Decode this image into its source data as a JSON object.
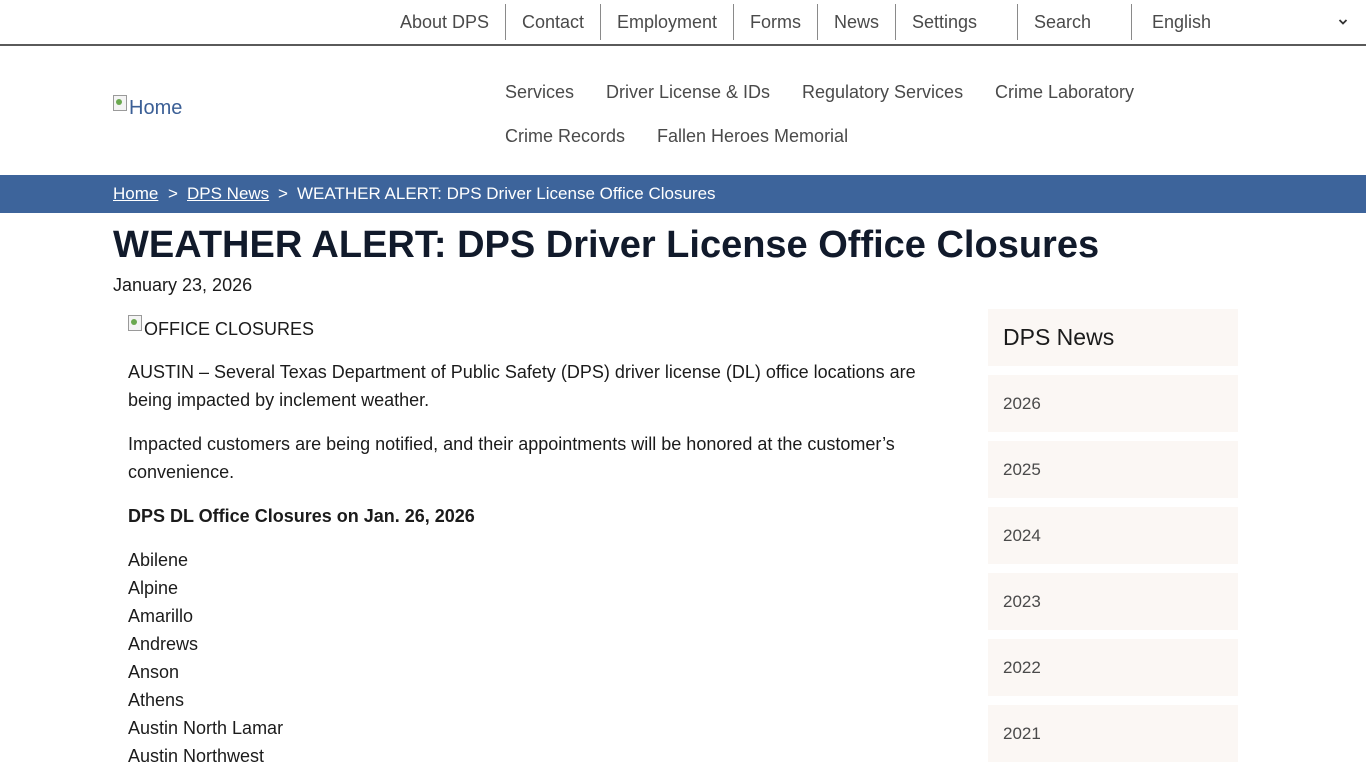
{
  "utility_nav": {
    "items": [
      "About DPS",
      "Contact",
      "Employment",
      "Forms",
      "News",
      "Settings",
      "Search"
    ],
    "language": {
      "selected": "English",
      "icon": "chevron-down-icon"
    }
  },
  "header": {
    "logo_alt": "Home",
    "main_nav": [
      "Services",
      "Driver License & IDs",
      "Regulatory Services",
      "Crime Laboratory",
      "Crime Records",
      "Fallen Heroes Memorial"
    ]
  },
  "breadcrumb": {
    "items": [
      "Home",
      "DPS News",
      "WEATHER ALERT: DPS Driver License Office Closures"
    ],
    "separator": ">"
  },
  "article": {
    "title": "WEATHER ALERT: DPS Driver License Office Closures",
    "date": "January 23, 2026",
    "image_alt": "OFFICE CLOSURES",
    "paragraphs": [
      "AUSTIN – Several Texas Department of Public Safety (DPS) driver license (DL) office locations are being impacted by inclement weather.",
      "Impacted customers are being notified, and their appointments will be honored at the customer’s convenience."
    ],
    "closures_heading": "DPS DL Office Closures on Jan. 26, 2026",
    "offices": [
      "Abilene",
      "Alpine",
      "Amarillo",
      "Andrews",
      "Anson",
      "Athens",
      "Austin North Lamar",
      "Austin Northwest"
    ]
  },
  "sidebar": {
    "title": "DPS News",
    "years": [
      "2026",
      "2025",
      "2024",
      "2023",
      "2022",
      "2021"
    ]
  },
  "colors": {
    "breadcrumb_bg": "#3d649b",
    "sidebar_bg": "#fbf7f4",
    "link": "#3b5f96",
    "title": "#111a2b"
  }
}
